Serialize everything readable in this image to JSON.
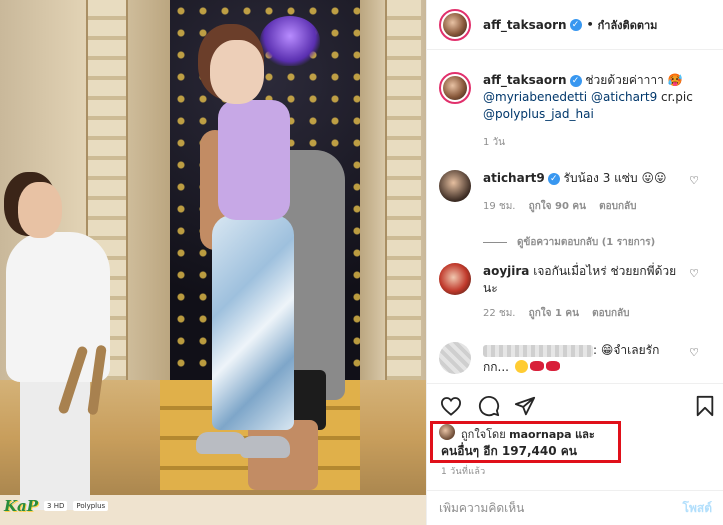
{
  "header": {
    "username": "aff_taksaorn",
    "separator": "•",
    "follow_status": "กำลังติดตาม"
  },
  "caption": {
    "username": "aff_taksaorn",
    "text": "ช่วยด้วยค่าาาา",
    "emoji": "🥵",
    "mentions": [
      "@myriabenedetti",
      "@atichart9",
      "cr.pic",
      "@polyplus_jad_hai"
    ],
    "time": "1 วัน"
  },
  "comments": [
    {
      "username": "atichart9",
      "text": "รับน้อง 3 แซ่บ",
      "emoji": "😛😛",
      "time": "19 ชม.",
      "likes": "ถูกใจ 90 คน",
      "reply": "ตอบกลับ",
      "view_replies": "ดูข้อความตอบกลับ (1 รายการ)"
    },
    {
      "username": "aoyjira",
      "text": "เจอกันเมื่อไหร่ ช่วยยกพี่ด้วยนะ",
      "time": "22 ชม.",
      "likes": "ถูกใจ 1 คน",
      "reply": "ตอบกลับ"
    },
    {
      "username_hidden": true,
      "text_line1": ":",
      "emoji_face": "😁",
      "text_line1b": "จำเลยรัก",
      "text_line2": "กก..."
    }
  ],
  "likes": {
    "prefix": "ถูกใจโดย",
    "user": "maornapa",
    "and": "และ",
    "others": "คนอื่นๆ อีก 197,440 คน"
  },
  "post_time": "1 วันที่แล้ว",
  "composer": {
    "placeholder": "เพิ่มความคิดเห็น",
    "post_label": "โพสต์"
  },
  "photo": {
    "logo_text": "KaP",
    "tv_text": "3 HD",
    "brand_text": "Polyplus"
  },
  "colors": {
    "link": "#00376b",
    "verified": "#3897f0",
    "highlight_box": "#e0101a",
    "post_disabled": "#b2dffc"
  },
  "icons": [
    "heart-icon",
    "comment-icon",
    "share-icon",
    "bookmark-icon",
    "verified-icon"
  ]
}
